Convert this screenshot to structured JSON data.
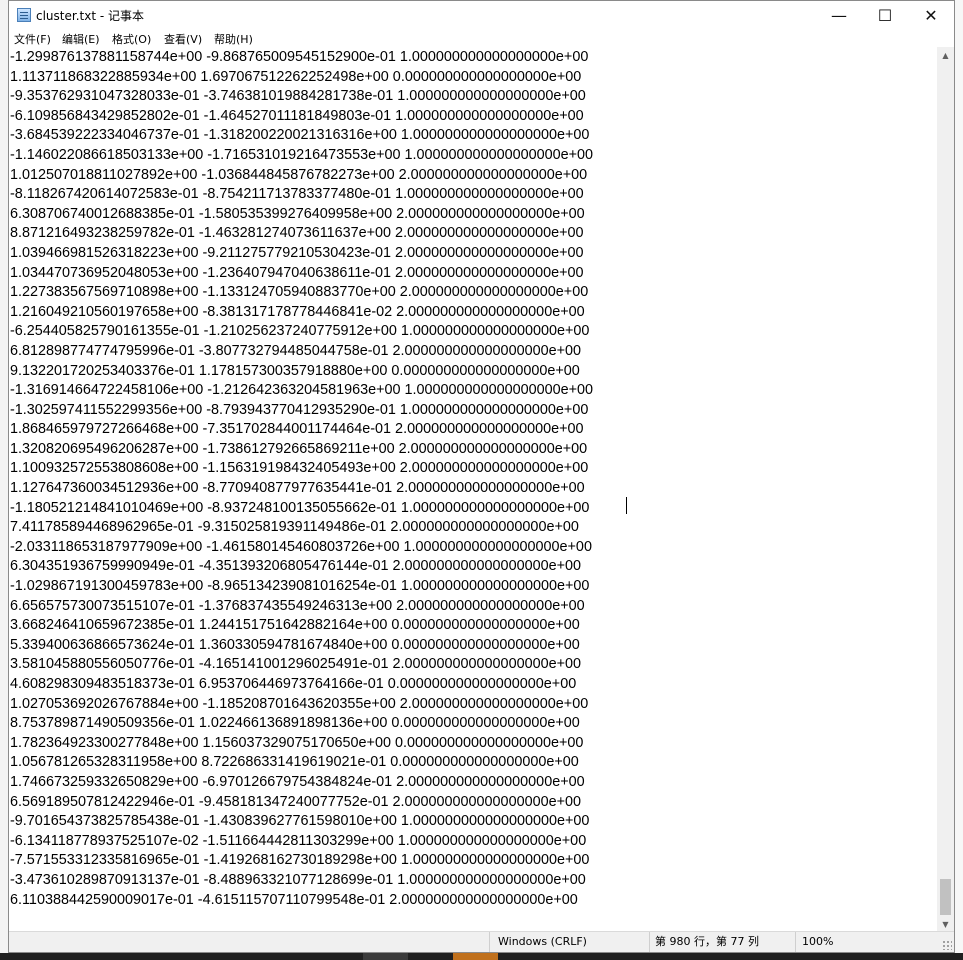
{
  "window": {
    "title": "cluster.txt - 记事本",
    "controls": {
      "minimize": "—",
      "maximize": "☐",
      "close": "✕"
    }
  },
  "menu": {
    "items": [
      "文件(F)",
      "编辑(E)",
      "格式(O)",
      "查看(V)",
      "帮助(H)"
    ]
  },
  "editor": {
    "lines": [
      "-1.299876137881158744e+00 -9.868765009545152900e-01 1.000000000000000000e+00",
      "1.113711868322885934e+00 1.697067512262252498e+00 0.000000000000000000e+00",
      "-9.353762931047328033e-01 -3.746381019884281738e-01 1.000000000000000000e+00",
      "-6.109856843429852802e-01 -1.464527011181849803e-01 1.000000000000000000e+00",
      "-3.684539222334046737e-01 -1.318200220021316316e+00 1.000000000000000000e+00",
      "-1.146022086618503133e+00 -1.716531019216473553e+00 1.000000000000000000e+00",
      "1.012507018811027892e+00 -1.036844845876782273e+00 2.000000000000000000e+00",
      "-8.118267420614072583e-01 -8.754211713783377480e-01 1.000000000000000000e+00",
      "6.308706740012688385e-01 -1.580535399276409958e+00 2.000000000000000000e+00",
      "8.871216493238259782e-01 -1.463281274073611637e+00 2.000000000000000000e+00",
      "1.039466981526318223e+00 -9.211275779210530423e-01 2.000000000000000000e+00",
      "1.034470736952048053e+00 -1.236407947040638611e-01 2.000000000000000000e+00",
      "1.227383567569710898e+00 -1.133124705940883770e+00 2.000000000000000000e+00",
      "1.216049210560197658e+00 -8.381317178778446841e-02 2.000000000000000000e+00",
      "-6.254405825790161355e-01 -1.210256237240775912e+00 1.000000000000000000e+00",
      "6.812898774774795996e-01 -3.807732794485044758e-01 2.000000000000000000e+00",
      "9.132201720253403376e-01 1.178157300357918880e+00 0.000000000000000000e+00",
      "-1.316914664722458106e+00 -1.212642363204581963e+00 1.000000000000000000e+00",
      "-1.302597411552299356e+00 -8.793943770412935290e-01 1.000000000000000000e+00",
      "1.868465979727266468e+00 -7.351702844001174464e-01 2.000000000000000000e+00",
      "1.320820695496206287e+00 -1.738612792665869211e+00 2.000000000000000000e+00",
      "1.100932572553808608e+00 -1.156319198432405493e+00 2.000000000000000000e+00",
      "1.127647360034512936e+00 -8.770940877977635441e-01 2.000000000000000000e+00",
      "-1.180521214841010469e+00 -8.937248100135055662e-01 1.000000000000000000e+00",
      "7.411785894468962965e-01 -9.315025819391149486e-01 2.000000000000000000e+00",
      "-2.033118653187977909e+00 -1.461580145460803726e+00 1.000000000000000000e+00",
      "6.304351936759990949e-01 -4.351393206805476144e-01 2.000000000000000000e+00",
      "-1.029867191300459783e+00 -8.965134239081016254e-01 1.000000000000000000e+00",
      "6.656575730073515107e-01 -1.376837435549246313e+00 2.000000000000000000e+00",
      "3.668246410659672385e-01 1.244151751642882164e+00 0.000000000000000000e+00",
      "5.339400636866573624e-01 1.360330594781674840e+00 0.000000000000000000e+00",
      "3.581045880556050776e-01 -4.165141001296025491e-01 2.000000000000000000e+00",
      "4.608298309483518373e-01 6.953706446973764166e-01 0.000000000000000000e+00",
      "1.027053692026767884e+00 -1.185208701643620355e+00 2.000000000000000000e+00",
      "8.753789871490509356e-01 1.022466136891898136e+00 0.000000000000000000e+00",
      "1.782364923300277848e+00 1.156037329075170650e+00 0.000000000000000000e+00",
      "1.056781265328311958e+00 8.722686331419619021e-01 0.000000000000000000e+00",
      "1.746673259332650829e+00 -6.970126679754384824e-01 2.000000000000000000e+00",
      "6.569189507812422946e-01 -9.458181347240077752e-01 2.000000000000000000e+00",
      "-9.701654373825785438e-01 -1.430839627761598010e+00 1.000000000000000000e+00",
      "-6.134118778937525107e-02 -1.511664442811303299e+00 1.000000000000000000e+00",
      "-7.571553312335816965e-01 -1.419268162730189298e+00 1.000000000000000000e+00",
      "-3.473610289870913137e-01 -8.488963321077128699e-01 1.000000000000000000e+00",
      "6.110388442590009017e-01 -4.615115707110799548e-01 2.000000000000000000e+00"
    ]
  },
  "status": {
    "encoding": "Windows (CRLF)",
    "position": "第 980 行，第 77 列",
    "zoom": "100%"
  },
  "scrollbar": {
    "up_icon": "▲",
    "down_icon": "▼"
  }
}
